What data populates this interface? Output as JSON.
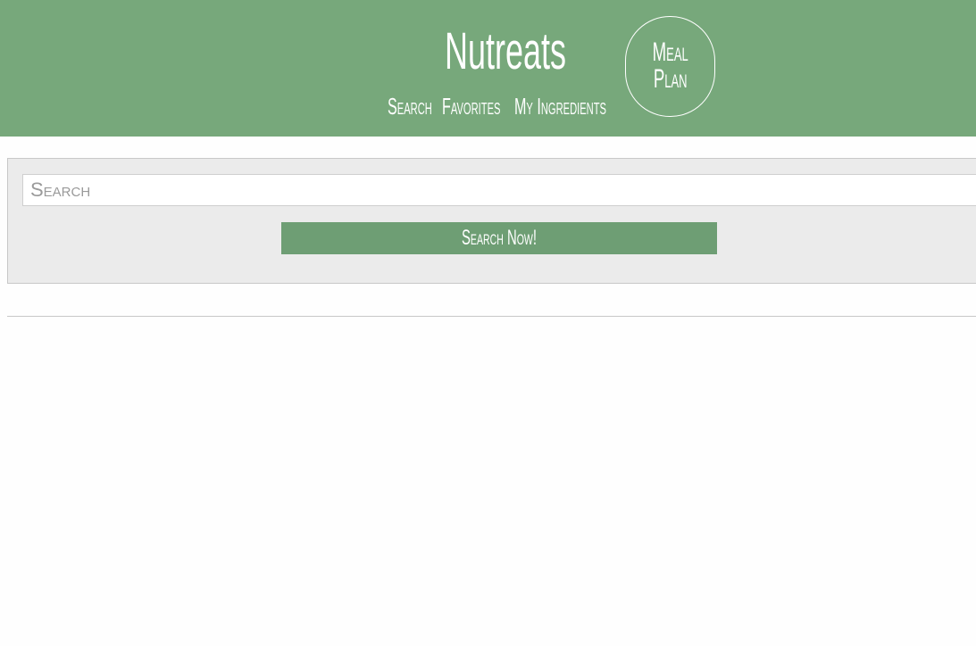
{
  "header": {
    "brand": "Nutreats",
    "nav": {
      "search": "Search",
      "favorites": "Favorites",
      "my_ingredients": "My Ingredients"
    },
    "meal_plan": "Meal\nPlan",
    "background_color": "#77a87b"
  },
  "search": {
    "placeholder": "Search",
    "value": "",
    "button_label": "Search Now!",
    "button_color": "#6e9e74",
    "panel_color": "#ebebeb"
  }
}
